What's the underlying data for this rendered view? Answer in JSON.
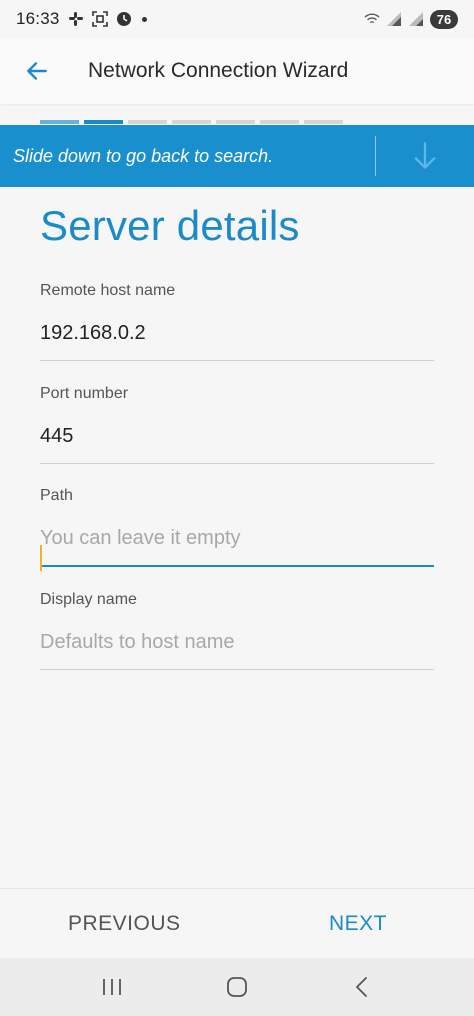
{
  "status_bar": {
    "time": "16:33",
    "battery": "76",
    "icons": [
      "slack-icon",
      "screenshot-icon",
      "timer-icon",
      "wifi-calling-icon",
      "signal-icon",
      "signal-icon-2"
    ]
  },
  "app_bar": {
    "title": "Network Connection Wizard",
    "back_icon": "arrow-left-icon"
  },
  "progress": {
    "total_steps": 7,
    "current_step": 2
  },
  "banner": {
    "text": "Slide down to go back to search.",
    "icon": "arrow-down-icon"
  },
  "form": {
    "title": "Server details",
    "fields": [
      {
        "label": "Remote host name",
        "value": "192.168.0.2",
        "placeholder": ""
      },
      {
        "label": "Port number",
        "value": "445",
        "placeholder": ""
      },
      {
        "label": "Path",
        "value": "",
        "placeholder": "You can leave it empty",
        "focused": true
      },
      {
        "label": "Display name",
        "value": "",
        "placeholder": "Defaults to host name"
      }
    ]
  },
  "buttons": {
    "previous": "PREVIOUS",
    "next": "NEXT"
  },
  "nav_bar": {
    "icons": [
      "recents-icon",
      "home-icon",
      "back-icon"
    ]
  },
  "colors": {
    "accent": "#1a8bc8",
    "banner": "#1a8fcd",
    "caret": "#f2b12b"
  }
}
